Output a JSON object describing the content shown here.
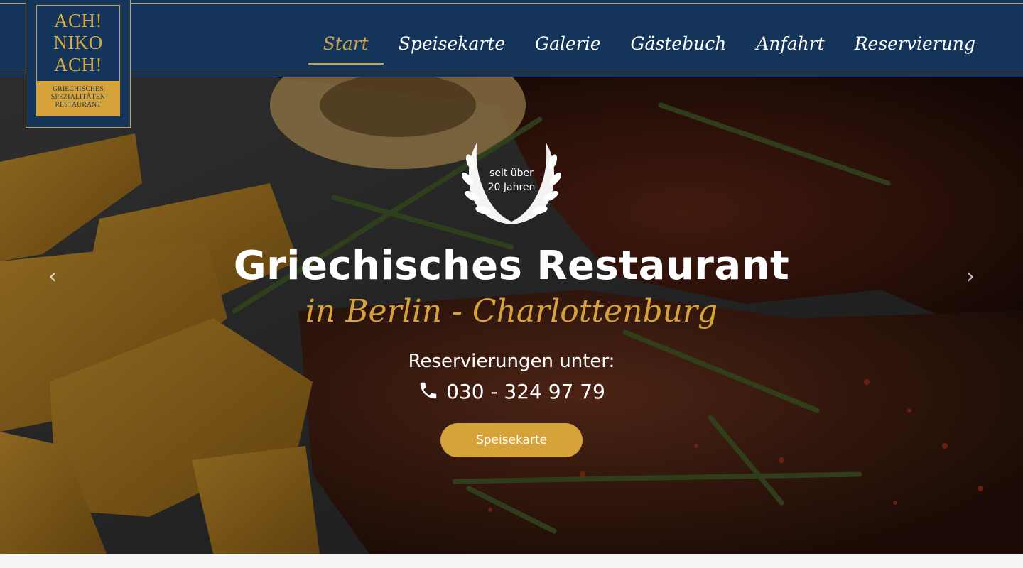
{
  "brand": {
    "logo_lines": [
      "ACH!",
      "NIKO",
      "ACH!"
    ],
    "logo_subtitle_lines": [
      "GRIECHISCHES",
      "SPEZIALITÄTEN",
      "RESTAURANT"
    ]
  },
  "nav": {
    "items": [
      {
        "label": "Start",
        "active": true
      },
      {
        "label": "Speisekarte",
        "active": false
      },
      {
        "label": "Galerie",
        "active": false
      },
      {
        "label": "Gästebuch",
        "active": false
      },
      {
        "label": "Anfahrt",
        "active": false
      },
      {
        "label": "Reservierung",
        "active": false
      }
    ]
  },
  "hero": {
    "badge_lines": [
      "seit über",
      "20 Jahren"
    ],
    "title": "Griechisches Restaurant",
    "subtitle": "in Berlin - Charlottenburg",
    "reservation_label": "Reservierungen unter:",
    "phone": "030 - 324 97 79",
    "cta_label": "Speisekarte",
    "prev_arrow": "‹",
    "next_arrow": "›"
  },
  "colors": {
    "navy": "#14345a",
    "gold": "#d6a23a",
    "text_on_dark": "#ffffff"
  },
  "icons": {
    "phone": "phone-icon",
    "laurel": "laurel-wreath-icon",
    "prev": "chevron-left-icon",
    "next": "chevron-right-icon"
  }
}
